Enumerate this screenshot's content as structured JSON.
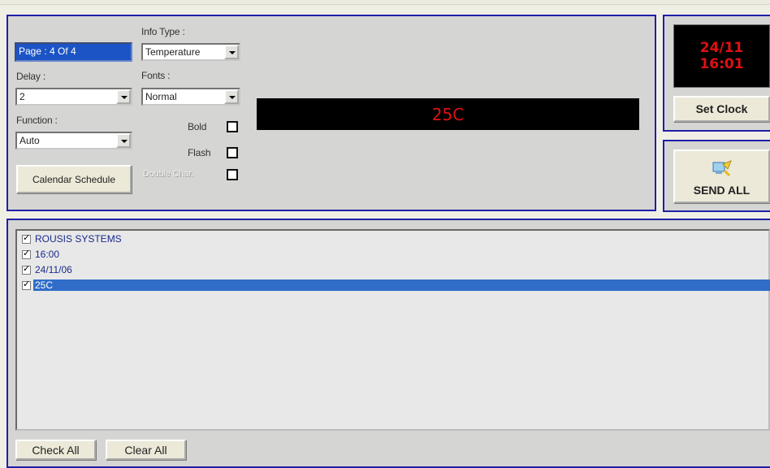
{
  "settings": {
    "page_field": "Page : 4 Of 4",
    "info_type_label": "Info Type :",
    "info_type_value": "Temperature",
    "delay_label": "Delay :",
    "delay_value": "2",
    "fonts_label": "Fonts :",
    "fonts_value": "Normal",
    "function_label": "Function :",
    "function_value": "Auto",
    "calendar_button": "Calendar Schedule",
    "bold_label": "Bold",
    "flash_label": "Flash",
    "double_char_label": "Double Char.",
    "bold_checked": false,
    "flash_checked": false,
    "double_char_checked": false
  },
  "preview": {
    "text": "25C",
    "color": "#e01010"
  },
  "clock": {
    "date": "24/11",
    "time": "16:01",
    "set_clock_button": "Set Clock"
  },
  "send": {
    "send_all_button": "SEND ALL",
    "icon": "send-all-icon"
  },
  "messages": {
    "items": [
      {
        "label": "ROUSIS SYSTEMS",
        "checked": true,
        "selected": false
      },
      {
        "label": "16:00",
        "checked": true,
        "selected": false
      },
      {
        "label": "24/11/06",
        "checked": true,
        "selected": false
      },
      {
        "label": "25C",
        "checked": true,
        "selected": true
      }
    ],
    "check_all_button": "Check All",
    "clear_all_button": "Clear All"
  },
  "colors": {
    "panel_border": "#1f1fa8",
    "selection": "#2f6dc8",
    "led_text": "#e01010"
  }
}
